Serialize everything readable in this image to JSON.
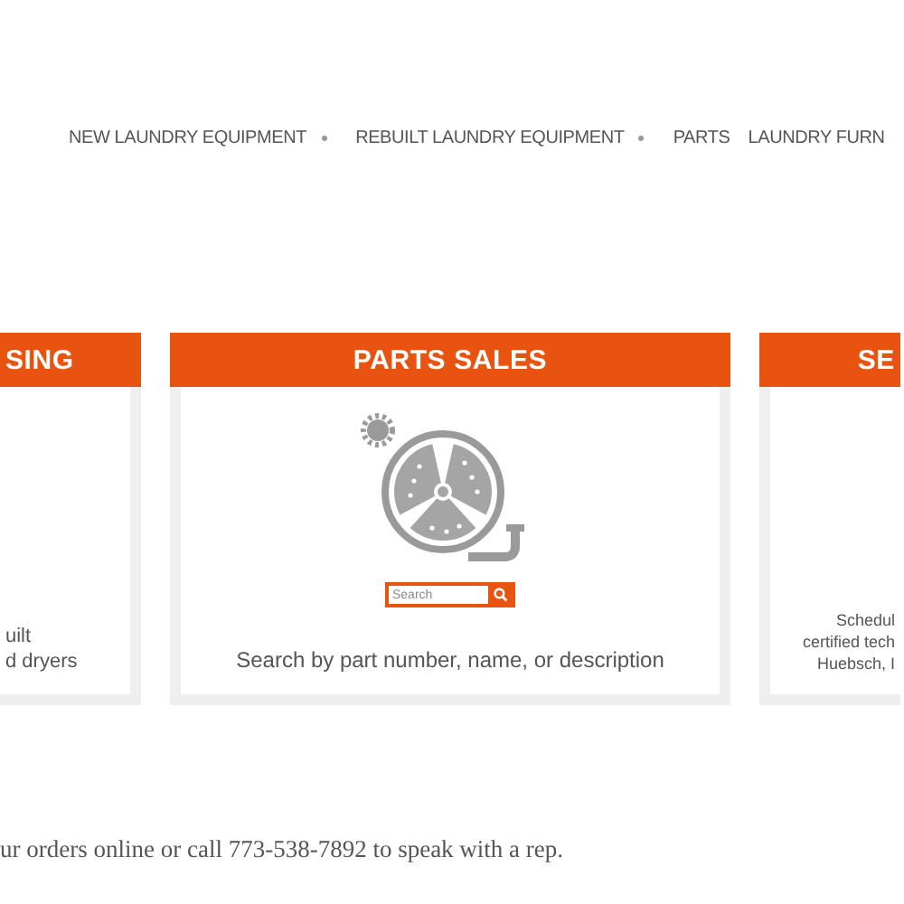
{
  "nav": [
    {
      "label": "NEW LAUNDRY EQUIPMENT",
      "dropdown": true
    },
    {
      "label": "REBUILT LAUNDRY EQUIPMENT",
      "dropdown": true
    },
    {
      "label": "PARTS",
      "dropdown": false
    },
    {
      "label": "LAUNDRY FURN",
      "dropdown": false
    }
  ],
  "cards": [
    {
      "kind": "left",
      "title": "SING",
      "lines": [
        "uilt",
        "d dryers"
      ]
    },
    {
      "kind": "parts",
      "title": "PARTS SALES",
      "search_placeholder": "Search",
      "lines": [
        "Search by part number, name, or description"
      ]
    },
    {
      "kind": "right",
      "title": "SE",
      "lines": [
        "Schedul",
        "certified tech",
        "Huebsch, I"
      ]
    }
  ],
  "footer_text": "ur orders online or call 773-538-7892 to speak with a rep."
}
